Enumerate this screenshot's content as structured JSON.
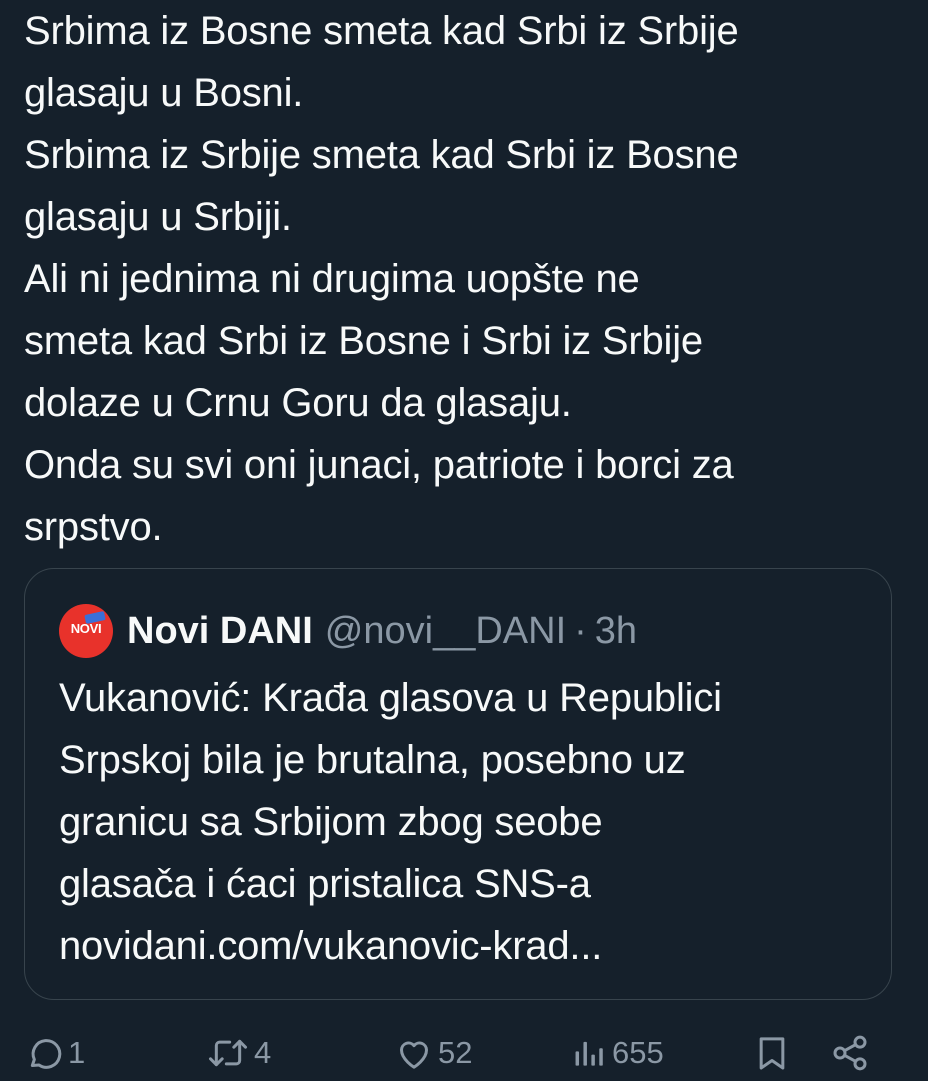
{
  "tweet": {
    "lines": [
      "Srbima iz Bosne smeta kad Srbi iz Srbije",
      "glasaju u Bosni.",
      "Srbima iz Srbije smeta kad Srbi iz Bosne",
      "glasaju u Srbiji.",
      "Ali ni jednima ni drugima uopšte ne",
      "smeta kad Srbi iz Bosne i Srbi iz Srbije",
      "dolaze u Crnu Goru da glasaju.",
      "Onda su svi oni junaci, patriote i borci za",
      "srpstvo."
    ]
  },
  "quoted_tweet": {
    "avatar_text": "NOVI",
    "name": "Novi DANI",
    "handle": "@novi__DANI",
    "separator": "·",
    "time": "3h",
    "lines": [
      "Vukanović: Krađa glasova u Republici",
      "Srpskoj bila je brutalna, posebno uz",
      "granicu sa Srbijom zbog seobe",
      "glasača i ćaci pristalica SNS-a",
      "novidani.com/vukanovic-krad..."
    ]
  },
  "actions": {
    "reply_count": "1",
    "retweet_count": "4",
    "like_count": "52",
    "view_count": "655"
  },
  "colors": {
    "background": "#15202b",
    "text": "#f7f9f9",
    "muted": "#8b98a5",
    "border": "#38444d",
    "avatar": "#e8322b"
  }
}
